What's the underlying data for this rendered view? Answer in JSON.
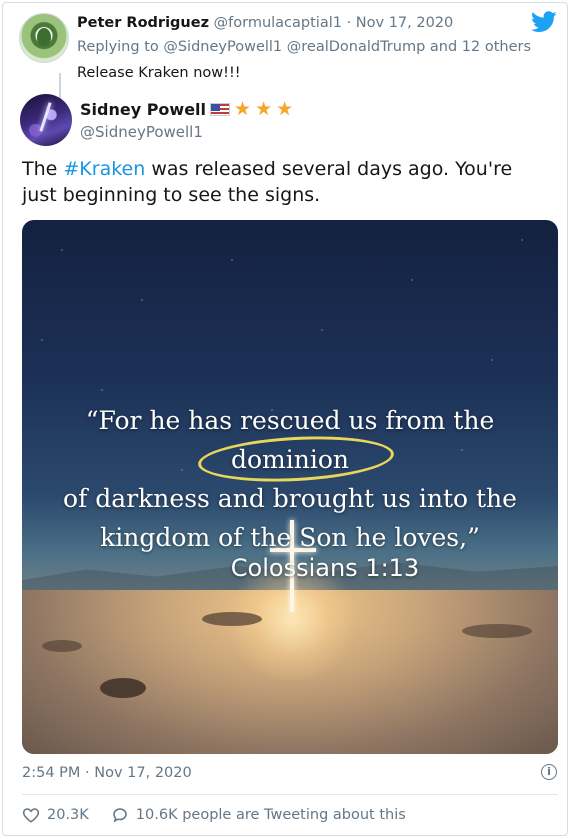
{
  "parent_tweet": {
    "name": "Peter Rodriguez",
    "handle_date": "@formulacaptial1 · Nov 17, 2020",
    "replying_to": "Replying to @SidneyPowell1 @realDonaldTrump and 12 others",
    "text": "Release Kraken now!!!"
  },
  "tweet": {
    "name": "Sidney Powell",
    "name_emojis": [
      "us-flag-icon",
      "star-icon",
      "star-icon",
      "star-icon"
    ],
    "handle": "@SidneyPowell1",
    "text_before": "The ",
    "hashtag": "#Kraken",
    "text_after": " was released several days ago. You're just beginning to see the signs.",
    "timestamp": "2:54 PM · Nov 17, 2020",
    "likes": "20.3K",
    "tweeting_about": "10.6K people are Tweeting about this"
  },
  "media": {
    "quote_line1": "“For he has rescued us from the",
    "quote_line2": "dominion",
    "quote_line3": "of darkness and brought us into the",
    "quote_line4": "kingdom of the Son he loves,”",
    "verse": "Colossians 1:13"
  },
  "colors": {
    "link": "#1b95e0",
    "muted": "#657786",
    "star": "#f4a62a",
    "highlight_oval": "#e9d65a"
  }
}
